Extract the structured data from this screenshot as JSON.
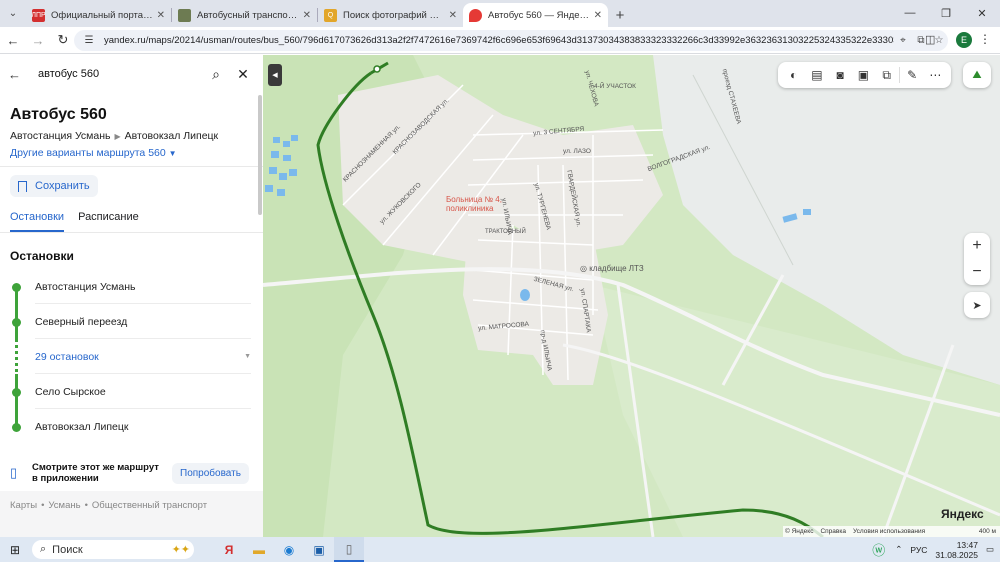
{
  "browser": {
    "tabs": [
      {
        "label": "Официальный портал ОАО «Л",
        "favicon_color": "#d32f2f",
        "favicon_text": "ЛПР",
        "active": false
      },
      {
        "label": "Автобусный транспорт город",
        "favicon_color": "#6d7b52",
        "favicon_text": "",
        "active": false
      },
      {
        "label": "Поиск фотографий — Автобу",
        "favicon_color": "#e2a62a",
        "favicon_text": "Q",
        "active": false
      },
      {
        "label": "Автобус 560 — Яндекс Карты",
        "favicon_color": "#e53935",
        "favicon_text": "",
        "active": true
      }
    ],
    "url": "yandex.ru/maps/20214/usman/routes/bus_560/796d617073626d313a2f2f7472616e7369742f6c696e653f69643d31373034383833323332266c3d33992e36323631303225324335322e333038",
    "profile_letter": "E"
  },
  "panel": {
    "search_query": "автобус 560",
    "route_title": "Автобус 560",
    "route_from": "Автостанция Усмань",
    "route_to": "Автовокзал Липецк",
    "variants_link": "Другие варианты маршрута 560",
    "save_label": "Сохранить",
    "tabs": [
      "Остановки",
      "Расписание"
    ],
    "stops_heading": "Остановки",
    "stops": [
      "Автостанция Усмань",
      "Северный переезд",
      "29 остановок",
      "Село Сырское",
      "Автовокзал Липецк"
    ],
    "promo_text": "Смотрите этот же маршрут в приложении",
    "promo_button": "Попробовать",
    "breadcrumbs": [
      "Карты",
      "Усмань",
      "Общественный транспорт"
    ]
  },
  "map": {
    "logo": "Яндекс",
    "footer": [
      "© Яндекс",
      "Справка",
      "Условия использования",
      "400 м"
    ],
    "zoom_in": "+",
    "zoom_out": "−",
    "labels": {
      "hospital": "Больница № 4, поликлиника",
      "cemetery": "кладбище ЛТЗ",
      "district": "ТРАКТОРНЫЙ",
      "area4": "4-Й УЧАСТОК",
      "streets": [
        "ул. 3 СЕНТЯБРЯ",
        "ул. ЛАЗО",
        "ВОЛГОГРАДСКАЯ ул.",
        "КРАСНОЗАВОДСКАЯ ул.",
        "КРАСНОЗНАМЕННАЯ ул.",
        "ул. ЖУКОВСКОГО",
        "ул. ТУРГЕНЕВА",
        "ГВАРДЕЙСКАЯ ул.",
        "ЗЕЛЕНАЯ ул.",
        "ул. МАТРОСОВА",
        "ул. СПАРТАКА",
        "пр-д ИЛЬИЧА",
        "проезд СТАХЕЕВА",
        "ул. ЧЕХОВА",
        "ул. ИЛЬИЧА"
      ]
    },
    "route_color": "#2f7d24"
  },
  "taskbar": {
    "search_placeholder": "Поиск",
    "lang": "РУС",
    "time": "13:47",
    "date": "31.08.2025"
  }
}
